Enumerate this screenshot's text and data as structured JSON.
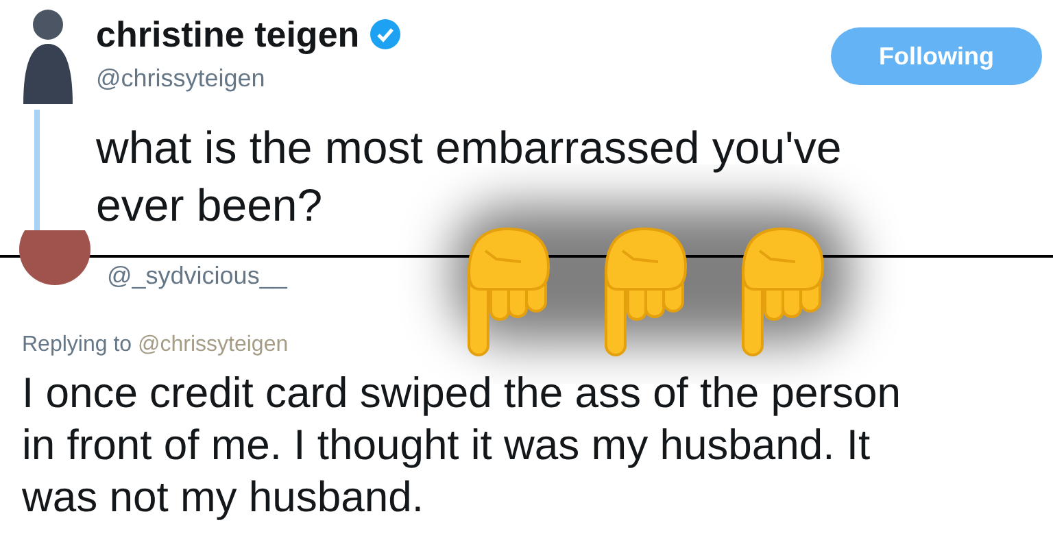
{
  "tweet": {
    "author": "christine teigen",
    "verified": true,
    "handle": "@chrissyteigen",
    "follow_button": {
      "label": "Following"
    },
    "text": "what is the most embarrassed you've ever been?"
  },
  "reply": {
    "handle": "@_sydvicious__",
    "replying_label": "Replying to",
    "replying_to": "@chrissyteigen",
    "text": "I once credit card swiped the ass of the person in front of me. I thought it was my husband. It was not my husband."
  }
}
